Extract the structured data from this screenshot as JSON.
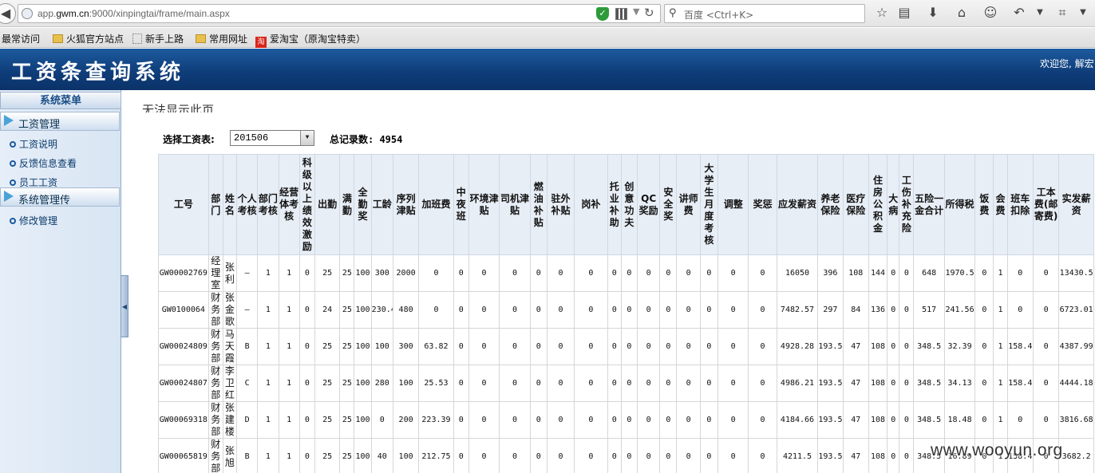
{
  "browser": {
    "url_prefix": "app.",
    "url_domain": "gwm.cn",
    "url_rest": ":9000/xinpingtai/frame/main.aspx",
    "search_placeholder": "百度 <Ctrl+K>",
    "bookmarks": [
      "最常访问",
      "火狐官方站点",
      "新手上路",
      "常用网址",
      "爱淘宝（原淘宝特卖）"
    ],
    "taobao_glyph": "淘"
  },
  "header": {
    "title": "工资条查询系统",
    "welcome": "欢迎您, 解宏"
  },
  "sidebar": {
    "title": "系统菜单",
    "groups": [
      {
        "label": "工资管理",
        "items": [
          "工资说明",
          "反馈信息查看",
          "员工工资"
        ]
      },
      {
        "label": "系统管理传",
        "items": [
          "修改管理"
        ]
      }
    ]
  },
  "main": {
    "cannot_show": "无法显示此页",
    "select_label": "选择工资表:",
    "period_value": "201506",
    "total_label": "总记录数: 4954"
  },
  "table": {
    "headers": [
      "工号",
      "部门",
      "姓名",
      "个人考核",
      "部门考核",
      "经营体考核",
      "科级以上绩效激励",
      "出勤",
      "满勤",
      "全勤奖",
      "工龄",
      "序列津贴",
      "加班费",
      "中夜班",
      "环境津贴",
      "司机津贴",
      "燃油补贴",
      "驻外补贴",
      "岗补",
      "托业补助",
      "创意功夫",
      "QC奖励",
      "安全奖",
      "讲师费",
      "大学生月度考核",
      "调整",
      "奖惩",
      "应发薪资",
      "养老保险",
      "医疗保险",
      "住房公积金",
      "大病",
      "工伤补充险",
      "五险一金合计",
      "所得税",
      "饭费",
      "会费",
      "班车扣除",
      "工本费(邮寄费)",
      "实发薪资"
    ],
    "rows": [
      [
        "GW00002769",
        "经理室",
        "张利",
        "–",
        "1",
        "1",
        "0",
        "25",
        "25",
        "100",
        "300",
        "2000",
        "0",
        "0",
        "0",
        "0",
        "0",
        "0",
        "0",
        "0",
        "0",
        "0",
        "0",
        "0",
        "0",
        "0",
        "0",
        "16050",
        "396",
        "108",
        "144",
        "0",
        "0",
        "648",
        "1970.5",
        "0",
        "1",
        "0",
        "0",
        "13430.5"
      ],
      [
        "GW0100064",
        "财务部",
        "张金歌",
        "–",
        "1",
        "1",
        "0",
        "24",
        "25",
        "100",
        "230.4",
        "480",
        "0",
        "0",
        "0",
        "0",
        "0",
        "0",
        "0",
        "0",
        "0",
        "0",
        "0",
        "0",
        "0",
        "0",
        "0",
        "7482.57",
        "297",
        "84",
        "136",
        "0",
        "0",
        "517",
        "241.56",
        "0",
        "1",
        "0",
        "0",
        "6723.01"
      ],
      [
        "GW00024809",
        "财务部",
        "马天霞",
        "B",
        "1",
        "1",
        "0",
        "25",
        "25",
        "100",
        "100",
        "300",
        "63.82",
        "0",
        "0",
        "0",
        "0",
        "0",
        "0",
        "0",
        "0",
        "0",
        "0",
        "0",
        "0",
        "0",
        "0",
        "4928.28",
        "193.5",
        "47",
        "108",
        "0",
        "0",
        "348.5",
        "32.39",
        "0",
        "1",
        "158.4",
        "0",
        "4387.99"
      ],
      [
        "GW00024807",
        "财务部",
        "李卫红",
        "C",
        "1",
        "1",
        "0",
        "25",
        "25",
        "100",
        "280",
        "100",
        "25.53",
        "0",
        "0",
        "0",
        "0",
        "0",
        "0",
        "0",
        "0",
        "0",
        "0",
        "0",
        "0",
        "0",
        "0",
        "4986.21",
        "193.5",
        "47",
        "108",
        "0",
        "0",
        "348.5",
        "34.13",
        "0",
        "1",
        "158.4",
        "0",
        "4444.18"
      ],
      [
        "GW00069318",
        "财务部",
        "张建楼",
        "D",
        "1",
        "1",
        "0",
        "25",
        "25",
        "100",
        "0",
        "200",
        "223.39",
        "0",
        "0",
        "0",
        "0",
        "0",
        "0",
        "0",
        "0",
        "0",
        "0",
        "0",
        "0",
        "0",
        "0",
        "4184.66",
        "193.5",
        "47",
        "108",
        "0",
        "0",
        "348.5",
        "18.48",
        "0",
        "1",
        "0",
        "0",
        "3816.68"
      ],
      [
        "GW00065819",
        "财务部",
        "张旭",
        "B",
        "1",
        "1",
        "0",
        "25",
        "25",
        "100",
        "40",
        "100",
        "212.75",
        "0",
        "0",
        "0",
        "0",
        "0",
        "0",
        "0",
        "0",
        "0",
        "0",
        "0",
        "0",
        "0",
        "0",
        "4211.5",
        "193.5",
        "47",
        "108",
        "0",
        "0",
        "348.5",
        "16.89",
        "0",
        "1",
        "158.4",
        "0",
        "3682.2"
      ]
    ]
  },
  "watermark": "www.wooyun.org"
}
